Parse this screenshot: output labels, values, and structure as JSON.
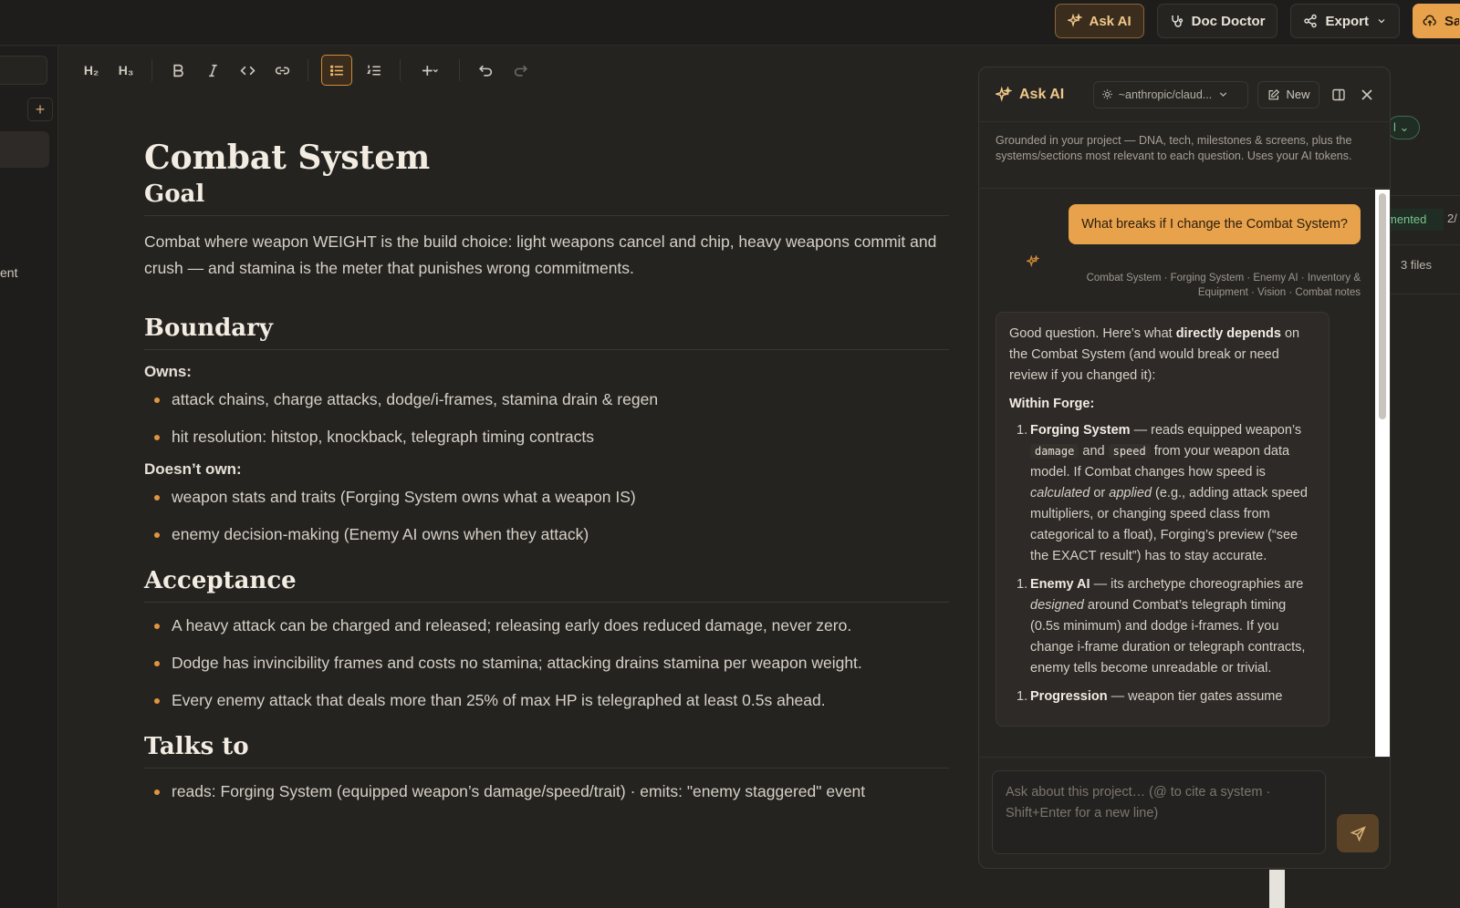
{
  "topbar": {
    "ask_ai": "Ask AI",
    "doc_doctor": "Doc Doctor",
    "export": "Export",
    "save": "Sa"
  },
  "toolbar": {
    "h2": "H₂",
    "h3": "H₃"
  },
  "sidebar": {
    "item_text": "ent"
  },
  "doc": {
    "title": "Combat System",
    "goal_heading": "Goal",
    "goal_text": "Combat where weapon WEIGHT is the build choice: light weapons cancel and chip, heavy weapons commit and crush — and stamina is the meter that punishes wrong commitments.",
    "boundary_heading": "Boundary",
    "owns_label": "Owns:",
    "owns": [
      "attack chains, charge attacks, dodge/i-frames, stamina drain & regen",
      "hit resolution: hitstop, knockback, telegraph timing contracts"
    ],
    "doesnt_own_label": "Doesn’t own:",
    "doesnt_own": [
      "weapon stats and traits (Forging System owns what a weapon IS)",
      "enemy decision-making (Enemy AI owns when they attack)"
    ],
    "acceptance_heading": "Acceptance",
    "acceptance": [
      "A heavy attack can be charged and released; releasing early does reduced damage, never zero.",
      "Dodge has invincibility frames and costs no stamina; attacking drains stamina per weapon weight.",
      "Every enemy attack that deals more than 25% of max HP is telegraphed at least 0.5s ahead."
    ],
    "talks_heading": "Talks to",
    "talks": [
      "reads: Forging System (equipped weapon’s damage/speed/trait) · emits: \"enemy staggered\" event"
    ]
  },
  "behind": {
    "status": "mented",
    "fraction": "2/",
    "files": "3 files"
  },
  "panel": {
    "title": "Ask AI",
    "model": "~anthropic/claud...",
    "new_label": "New",
    "description": "Grounded in your project — DNA, tech, milestones & screens, plus the systems/sections most relevant to each question. Uses your AI tokens.",
    "user_message": "What breaks if I change the Combat System?",
    "sources": "Combat System · Forging System · Enemy AI · Inventory & Equipment · Vision · Combat notes",
    "reply_intro_1": "Good question. Here’s what ",
    "reply_intro_bold": "directly depends",
    "reply_intro_2": " on the Combat System (and would break or need review if you changed it):",
    "reply_section": "Within Forge:",
    "item1_num": "1.",
    "item1_title": "Forging System",
    "item1_a": " — reads equipped weapon’s ",
    "item1_code1": "damage",
    "item1_and": " and ",
    "item1_code2": "speed",
    "item1_b": " from your weapon data model. If Combat changes how speed is ",
    "item1_em1": "calculated",
    "item1_or": " or ",
    "item1_em2": "applied",
    "item1_c": " (e.g., adding attack speed multipliers, or changing speed class from categorical to a float), Forging’s preview (“see the EXACT result”) has to stay accurate.",
    "item2_num": "1.",
    "item2_title": "Enemy AI",
    "item2_a": " — its archetype choreographies are ",
    "item2_em": "designed",
    "item2_b": " around Combat’s telegraph timing (0.5s minimum) and dodge i-frames. If you change i-frame duration or telegraph contracts, enemy tells become unreadable or trivial.",
    "item3_num": "1.",
    "item3_title": "Progression",
    "item3_a": " — weapon tier gates assume",
    "input_placeholder": "Ask about this project… (@ to cite a system · Shift+Enter for a new line)"
  }
}
